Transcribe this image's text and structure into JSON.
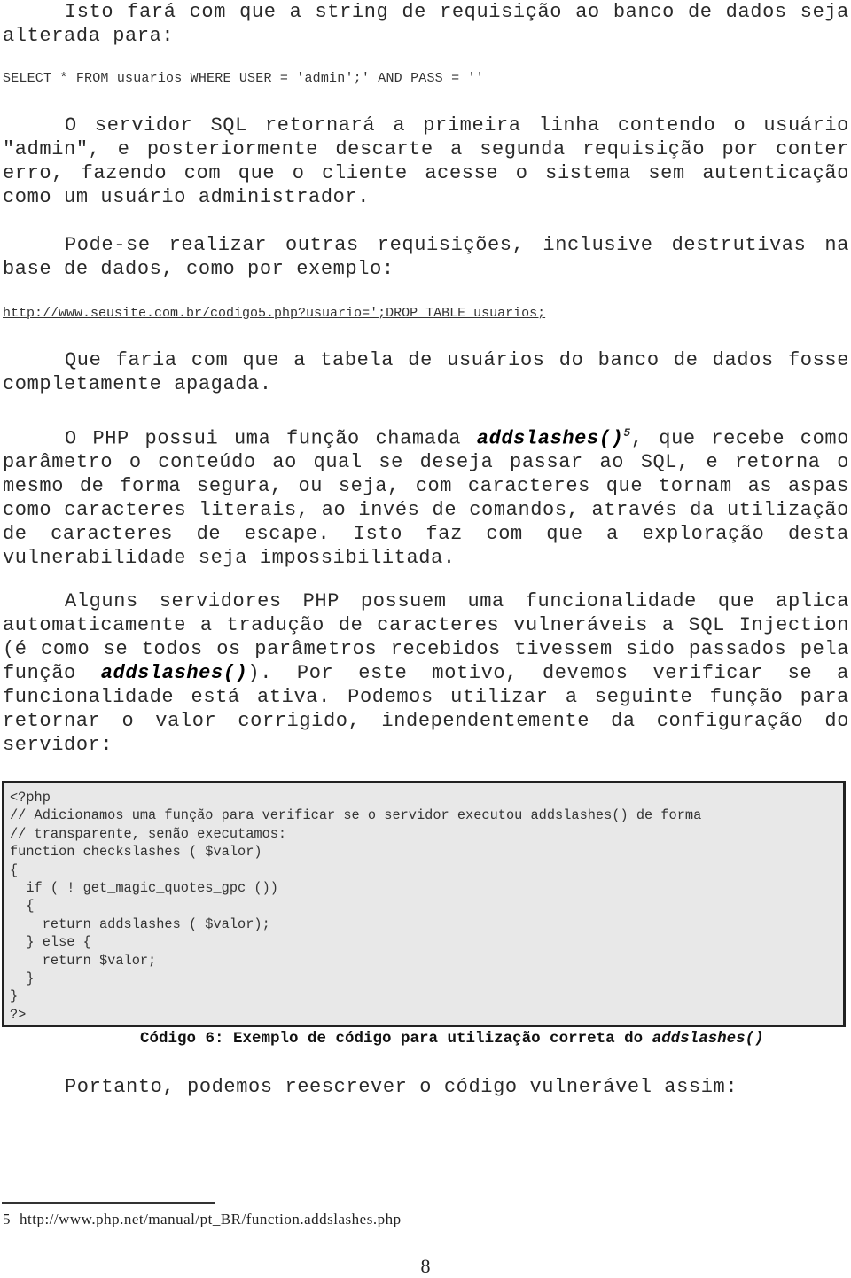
{
  "paragraphs": {
    "p1": "Isto fará com que a string de requisição ao banco de dados seja alterada para:",
    "sql_query": "SELECT * FROM usuarios WHERE USER = 'admin';' AND PASS = ''",
    "p2": "O servidor SQL retornará a primeira linha contendo o usuário \"admin\", e posteriormente descarte a segunda requisição por conter erro, fazendo com que o cliente acesse o sistema sem autenticação como um usuário administrador.",
    "p3": "Pode-se realizar outras requisições, inclusive destrutivas na base de dados, como por exemplo:",
    "example_url": "http://www.seusite.com.br/codigo5.php?usuario=';DROP TABLE usuarios;",
    "p4": "Que faria com que a tabela de usuários do banco de dados fosse completamente apagada.",
    "p5_before": "O PHP possui uma função chamada ",
    "p5_fn": "addslashes()",
    "p5_footnote_ref": "5",
    "p5_after": ", que recebe como parâmetro o conteúdo ao qual se deseja passar ao SQL, e retorna o mesmo de forma segura, ou seja, com caracteres que tornam as aspas como caracteres literais, ao invés de comandos, através da utilização de caracteres de escape. Isto faz com que a exploração desta vulnerabilidade seja impossibilitada.",
    "p6_before": "Alguns servidores PHP possuem uma funcionalidade que aplica automaticamente a tradução de caracteres vulneráveis a SQL Injection (é como se todos os parâmetros recebidos tivessem sido passados pela função ",
    "p6_fn": "addslashes()",
    "p6_after": "). Por este motivo, devemos verificar se a funcionalidade está ativa. Podemos utilizar a seguinte função para retornar o valor corrigido, independentemente da configuração do servidor:",
    "p7": "Portanto, podemos reescrever o código vulnerável assim:"
  },
  "code_block": {
    "lines": [
      "<?php",
      "// Adicionamos uma função para verificar se o servidor executou addslashes() de forma",
      "// transparente, senão executamos:",
      "function checkslashes ( $valor)",
      "{",
      "  if ( ! get_magic_quotes_gpc ())",
      "  {",
      "    return addslashes ( $valor);",
      "  } else {",
      "    return $valor;",
      "  }",
      "}",
      "?>"
    ],
    "caption_prefix": "Código 6: Exemplo de código para utilização correta do ",
    "caption_fn": "addslashes()"
  },
  "footnote": {
    "number": "5",
    "text": "http://www.php.net/manual/pt_BR/function.addslashes.php"
  },
  "page_number": "8"
}
